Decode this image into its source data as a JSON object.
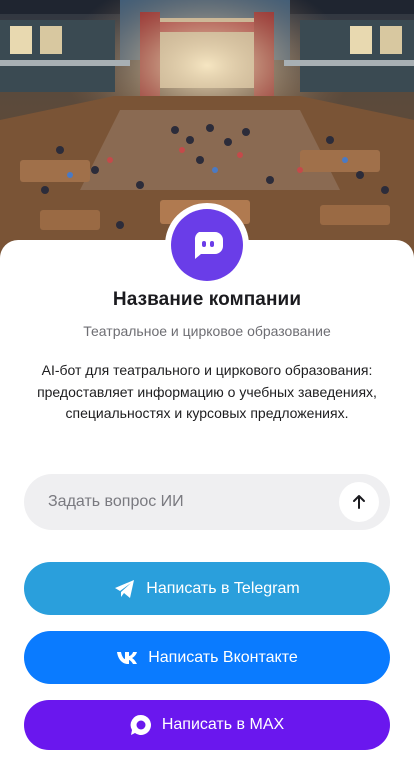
{
  "hero": {
    "icon": "theatre-hall-illustration"
  },
  "company": {
    "avatar_icon": "chat-bot-icon",
    "name": "Название компании",
    "tagline": "Театральное и цирковое образование",
    "description": "AI-бот для театрального и циркового образования: предоставляет информацию о учебных заведениях, специальностях и курсовых предложениях."
  },
  "ask": {
    "placeholder": "Задать вопрос ИИ",
    "value": "",
    "send_icon": "arrow-up-icon"
  },
  "actions": {
    "telegram": {
      "label": "Написать в Telegram",
      "icon": "telegram-icon",
      "color": "#2a9fdc"
    },
    "vk": {
      "label": "Написать Вконтакте",
      "icon": "vk-icon",
      "color": "#0a7bff"
    },
    "max": {
      "label": "Написать в MAX",
      "icon": "max-icon",
      "color": "#6a17ee"
    }
  },
  "colors": {
    "brand": "#6a3de8",
    "surface": "#efeff1"
  }
}
